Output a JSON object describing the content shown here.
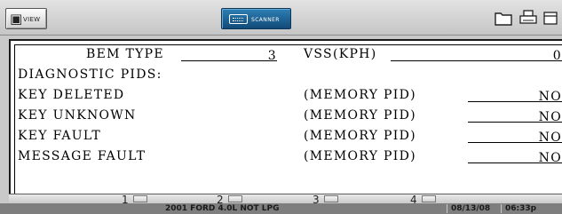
{
  "toolbar": {
    "view_label": "VIEW",
    "scanner_label": "SCANNER"
  },
  "pids": {
    "bem_type_label": "BEM TYPE",
    "bem_type_value": "3",
    "vss_label": "VSS(KPH)",
    "vss_value": "0",
    "section_header": "DIAGNOSTIC PIDS:",
    "rows": [
      {
        "label": "KEY DELETED",
        "qualifier": "(MEMORY PID)",
        "value": "NO"
      },
      {
        "label": "KEY UNKNOWN",
        "qualifier": "(MEMORY PID)",
        "value": "NO"
      },
      {
        "label": "KEY FAULT",
        "qualifier": "(MEMORY PID)",
        "value": "NO"
      },
      {
        "label": "MESSAGE FAULT",
        "qualifier": "(MEMORY PID)",
        "value": "NO"
      }
    ]
  },
  "pages": [
    "1",
    "2",
    "3",
    "4"
  ],
  "status_bar": {
    "vehicle": "2001 FORD 4.0L NOT LPG",
    "date": "08/13/08",
    "time": "06:33p"
  },
  "colors": {
    "scanner_button": "#1e5f93",
    "panel_background": "#ffffff",
    "status_bar": "#7e7e7e"
  },
  "icons": [
    "view-icon",
    "keyboard-icon",
    "folder-icon",
    "printer-icon",
    "tool-icon"
  ]
}
